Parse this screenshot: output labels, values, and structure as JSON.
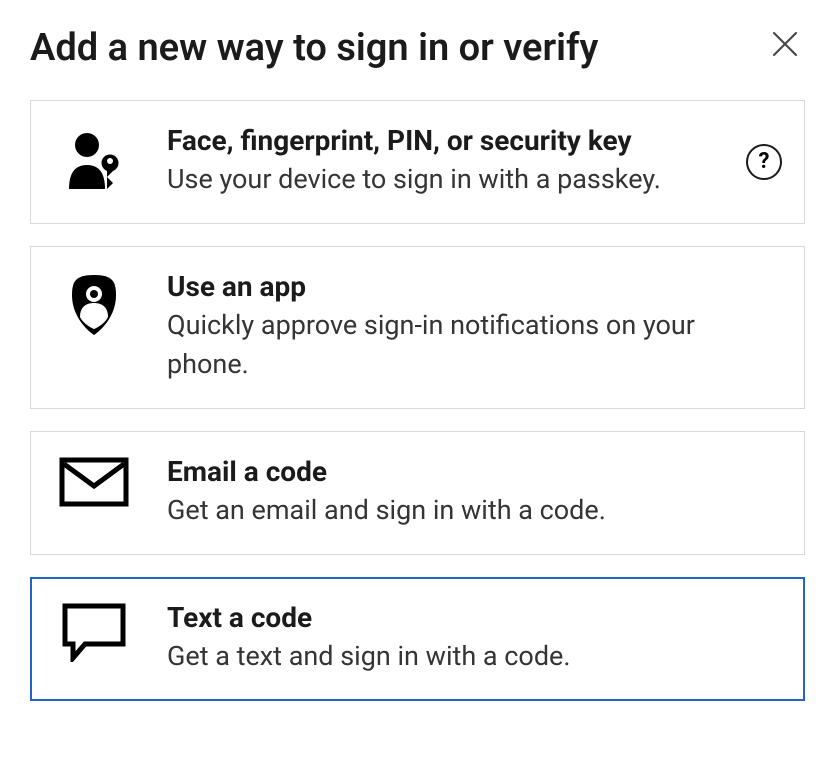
{
  "dialog": {
    "title": "Add a new way to sign in or verify",
    "help_glyph": "?"
  },
  "options": [
    {
      "title": "Face, fingerprint, PIN, or security key",
      "desc": "Use your device to sign in with a passkey.",
      "has_help": true
    },
    {
      "title": "Use an app",
      "desc": "Quickly approve sign-in notifications on your phone.",
      "has_help": false
    },
    {
      "title": "Email a code",
      "desc": "Get an email and sign in with a code.",
      "has_help": false
    },
    {
      "title": "Text a code",
      "desc": "Get a text and sign in with a code.",
      "has_help": false,
      "selected": true
    }
  ]
}
